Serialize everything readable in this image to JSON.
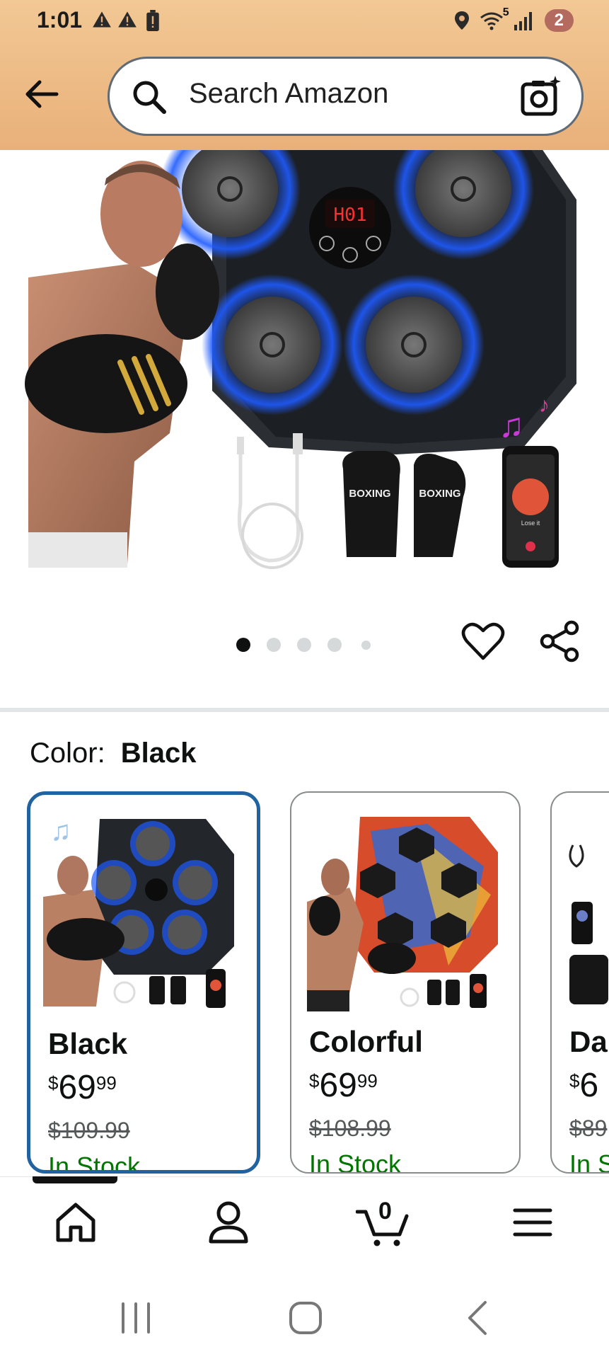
{
  "status_bar": {
    "time": "1:01",
    "wifi_label": "5",
    "notification_count": "2",
    "icons": [
      "warning-icon",
      "warning-icon",
      "battery-alert-icon",
      "location-icon",
      "wifi-icon",
      "signal-icon"
    ]
  },
  "search": {
    "placeholder": "Search Amazon",
    "icons": [
      "back-arrow-icon",
      "search-icon",
      "camera-icon"
    ]
  },
  "hero": {
    "image_index": 0,
    "image_count": 5,
    "display_text": "H01",
    "glove_text": "BOXING",
    "phone_text": "Lose it"
  },
  "actions": {
    "icons": [
      "heart-icon",
      "share-icon"
    ]
  },
  "color_selector": {
    "label": "Color:",
    "selected": "Black",
    "options": [
      {
        "name": "Black",
        "currency": "$",
        "price_whole": "69",
        "price_fraction": "99",
        "list_price": "$109.99",
        "availability": "In Stock"
      },
      {
        "name": "Colorful",
        "currency": "$",
        "price_whole": "69",
        "price_fraction": "99",
        "list_price": "$108.99",
        "availability": "In Stock"
      },
      {
        "name": "Da",
        "currency": "$",
        "price_whole": "6",
        "price_fraction": "",
        "list_price": "$89",
        "availability": "In S"
      }
    ]
  },
  "bottom_nav": {
    "cart_count": "0",
    "icons": [
      "home-icon",
      "account-icon",
      "cart-icon",
      "menu-icon"
    ]
  },
  "system_nav": {
    "icons": [
      "recents-icon",
      "home-circle-icon",
      "back-chevron-icon"
    ]
  },
  "colors": {
    "header_bg": "#EDB983",
    "selected_border": "#2162A1",
    "in_stock": "#007600",
    "led_blue": "#1E5BFF"
  }
}
